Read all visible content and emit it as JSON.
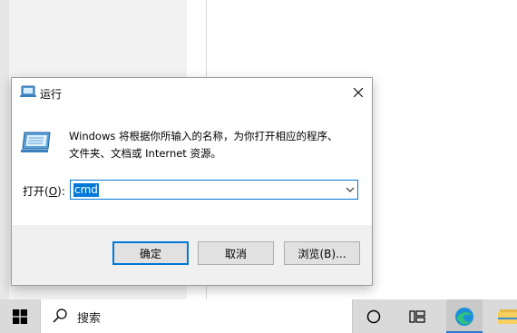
{
  "dialog": {
    "title": "运行",
    "description_line1": "Windows 将根据你所输入的名称，为你打开相应的程序、",
    "description_line2": "文件夹、文档或 Internet 资源。",
    "open_label_prefix": "打开(",
    "open_label_accel": "O",
    "open_label_suffix": "):",
    "open_value": "cmd",
    "buttons": {
      "ok": "确定",
      "cancel": "取消",
      "browse": "浏览(B)..."
    }
  },
  "taskbar": {
    "search_placeholder": "搜索"
  },
  "colors": {
    "accent": "#0078d7",
    "footer": "#f0f0f0",
    "taskbar": "#dadada"
  }
}
